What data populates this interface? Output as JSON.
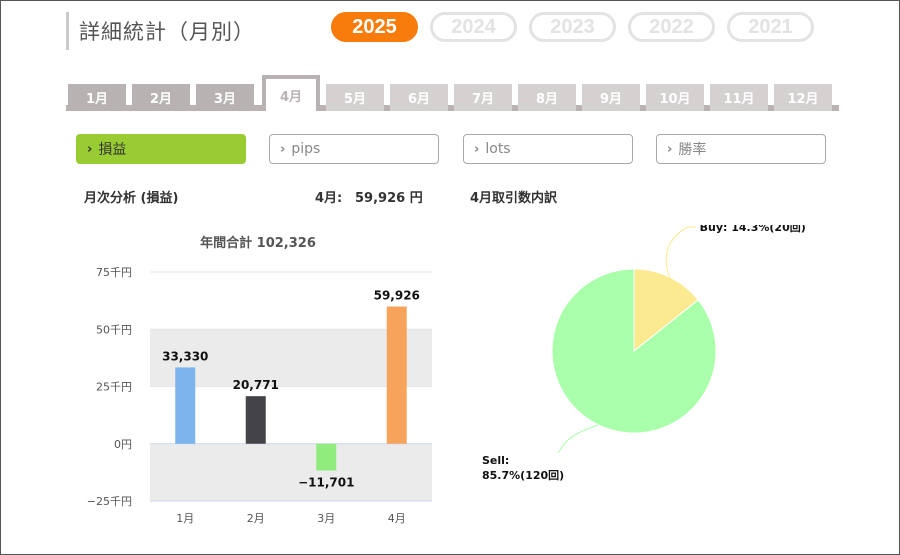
{
  "page": {
    "title": "詳細統計（月別）"
  },
  "years": [
    {
      "label": "2025",
      "active": true
    },
    {
      "label": "2024",
      "active": false
    },
    {
      "label": "2023",
      "active": false
    },
    {
      "label": "2022",
      "active": false
    },
    {
      "label": "2021",
      "active": false
    }
  ],
  "months": [
    {
      "label": "1月",
      "state": "dark"
    },
    {
      "label": "2月",
      "state": "dark"
    },
    {
      "label": "3月",
      "state": "dark"
    },
    {
      "label": "4月",
      "state": "active"
    },
    {
      "label": "5月",
      "state": "light"
    },
    {
      "label": "6月",
      "state": "light"
    },
    {
      "label": "7月",
      "state": "light"
    },
    {
      "label": "8月",
      "state": "light"
    },
    {
      "label": "9月",
      "state": "light"
    },
    {
      "label": "10月",
      "state": "light"
    },
    {
      "label": "11月",
      "state": "light"
    },
    {
      "label": "12月",
      "state": "light"
    }
  ],
  "metrics": [
    {
      "label": "損益",
      "active": true
    },
    {
      "label": "pips",
      "active": false
    },
    {
      "label": "lots",
      "active": false
    },
    {
      "label": "勝率",
      "active": false
    }
  ],
  "analysis": {
    "title": "月次分析 (損益)",
    "month_label": "4月:",
    "month_value": "59,926 円",
    "pie_title": "4月取引数内訳"
  },
  "colors": {
    "accent": "#f87c0c",
    "active_metric": "#99cc33"
  },
  "chart_data": [
    {
      "type": "bar",
      "title": "年間合計 102,326",
      "categories": [
        "1月",
        "2月",
        "3月",
        "4月"
      ],
      "values": [
        33330,
        20771,
        -11701,
        59926
      ],
      "data_labels": [
        "33,330",
        "20,771",
        "−11,701",
        "59,926"
      ],
      "bar_colors": [
        "#7cb5ec",
        "#434348",
        "#90ed7d",
        "#f7a35c"
      ],
      "yticks": [
        75000,
        50000,
        25000,
        0,
        -25000
      ],
      "ytick_labels": [
        "75千円",
        "50千円",
        "25千円",
        "0円",
        "−25千円"
      ],
      "ylim": [
        -25000,
        75000
      ],
      "grid": true
    },
    {
      "type": "pie",
      "slices": [
        {
          "label": "Buy: 14.3%(20回)",
          "value": 14.3,
          "count": 20,
          "color": "#fbea8f"
        },
        {
          "label_line1": "Sell:",
          "label_line2": "85.7%(120回)",
          "value": 85.7,
          "count": 120,
          "color": "#aaffaa"
        }
      ]
    }
  ]
}
